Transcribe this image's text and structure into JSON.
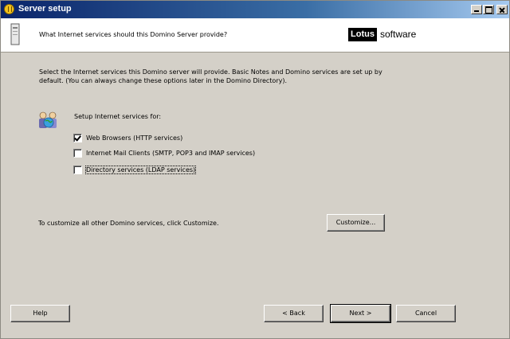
{
  "window": {
    "title": "Server setup",
    "controls": {
      "minimize": "minimize",
      "maximize": "maximize",
      "close": "close"
    }
  },
  "header": {
    "question": "What Internet services should this Domino Server provide?",
    "logo_brand": "Lotus",
    "logo_suffix": "software"
  },
  "intro_text": "Select the Internet services this Domino server will provide. Basic Notes and Domino services are set up by default. (You can always change these options later in the Domino Directory).",
  "setup_label": "Setup Internet services for:",
  "services": [
    {
      "label": "Web Browsers (HTTP services)",
      "checked": true
    },
    {
      "label": "Internet Mail Clients (SMTP, POP3 and IMAP services)",
      "checked": false
    },
    {
      "label": "Directory services (LDAP services)",
      "checked": false,
      "focused": true
    }
  ],
  "customize_text": "To customize all other Domino services, click Customize.",
  "buttons": {
    "customize": "Customize...",
    "help": "Help",
    "back": "< Back",
    "next": "Next >",
    "cancel": "Cancel"
  },
  "icons": {
    "title": "lotus-notes-icon",
    "document": "document-icon",
    "users": "users-globe-icon"
  }
}
